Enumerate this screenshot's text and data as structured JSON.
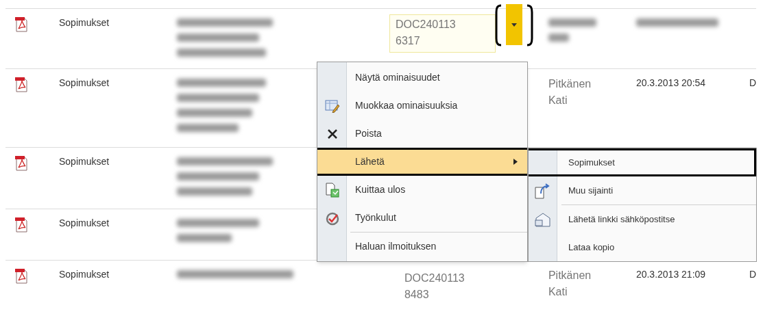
{
  "rows": [
    {
      "type": "Sopimukset",
      "description": {
        "kind": "blurred"
      },
      "doc_id": [
        "DOC240113",
        "6317"
      ],
      "doc_id_selected": true,
      "author": {
        "kind": "blurred"
      },
      "date": {
        "kind": "blurred"
      }
    },
    {
      "type": "Sopimukset",
      "description": {
        "kind": "blurred"
      },
      "author": {
        "kind": "text",
        "lines": [
          "Pitkänen",
          "Kati"
        ]
      },
      "date": {
        "kind": "text",
        "text": "20.3.2013 20:54"
      },
      "column_8": "D"
    },
    {
      "type": "Sopimukset",
      "description": {
        "kind": "blurred"
      }
    },
    {
      "type": "Sopimukset",
      "description": {
        "kind": "blurred"
      }
    },
    {
      "type": "Sopimukset",
      "description": {
        "kind": "blurred"
      },
      "doc_id": [
        "DOC240113",
        "8483"
      ],
      "doc_id_selected": false,
      "author": {
        "kind": "text",
        "lines": [
          "Pitkänen",
          "Kati"
        ]
      },
      "date": {
        "kind": "text",
        "text": "20.3.2013 21:09"
      },
      "column_8": "D"
    }
  ],
  "context_menu": {
    "items": [
      {
        "label": "Näytä ominaisuudet",
        "selected": false
      },
      {
        "label": "Muokkaa ominaisuuksia",
        "selected": false
      },
      {
        "label": "Poista",
        "selected": false
      },
      {
        "label": "Lähetä",
        "selected": true,
        "submenu": true
      },
      {
        "label": "Kuittaa ulos",
        "selected": false
      },
      {
        "label": "Työnkulut",
        "selected": false
      },
      {
        "label": "Haluan ilmoituksen",
        "selected": false,
        "separator_before": true
      }
    ]
  },
  "submenu": {
    "items": [
      {
        "label": "Sopimukset",
        "outlined": true
      },
      {
        "label": "Muu sijainti",
        "outlined": false
      },
      {
        "label": "Lähetä linkki sähköpostitse",
        "outlined": false,
        "separator_before": true
      },
      {
        "label": "Lataa kopio",
        "outlined": false
      }
    ]
  }
}
